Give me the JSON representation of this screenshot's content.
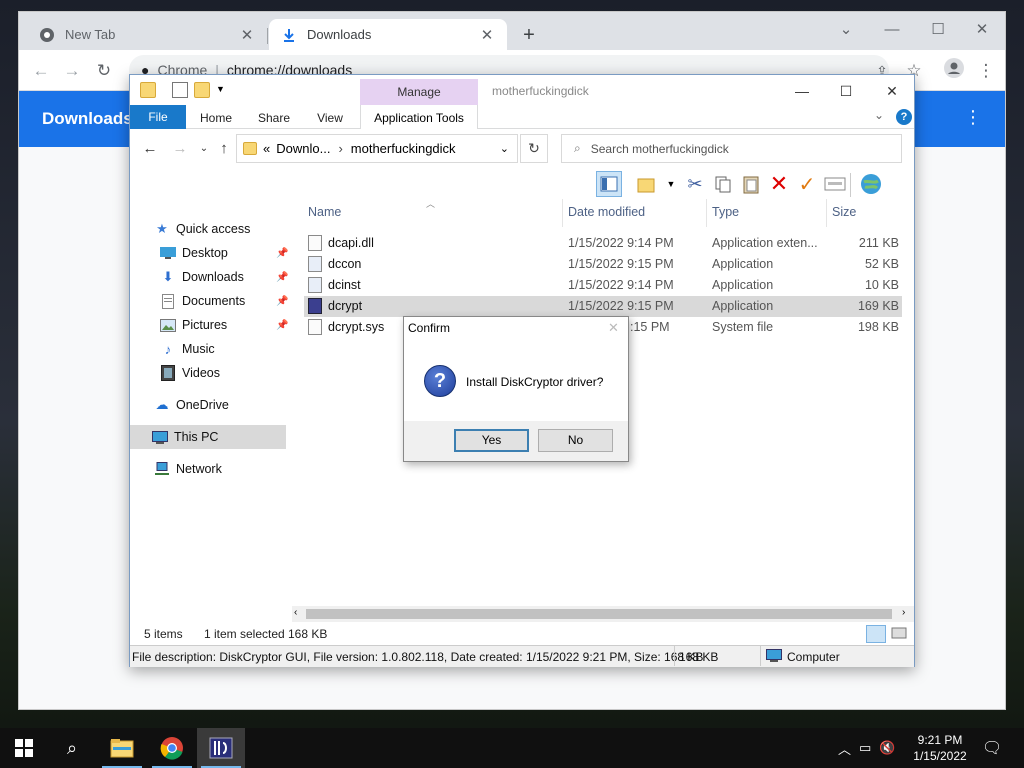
{
  "chrome": {
    "tabs": [
      {
        "label": "New Tab",
        "close": "✕"
      },
      {
        "label": "Downloads",
        "close": "✕"
      }
    ],
    "new_tab": "+",
    "omnibox": {
      "chip": "Chrome",
      "separator": "|",
      "url": "chrome://downloads"
    },
    "page_title": "Downloads"
  },
  "explorer": {
    "window_title": "motherfuckingdick",
    "contextual_group": "Manage",
    "ribbon_tabs": [
      "File",
      "Home",
      "Share",
      "View",
      "Application Tools"
    ],
    "address": {
      "prefix": "«",
      "crumbs": [
        "Downlo...",
        "motherfuckingdick"
      ]
    },
    "search_placeholder": "Search motherfuckingdick",
    "nav": [
      {
        "label": "Quick access"
      },
      {
        "label": "Desktop"
      },
      {
        "label": "Downloads"
      },
      {
        "label": "Documents"
      },
      {
        "label": "Pictures"
      },
      {
        "label": "Music"
      },
      {
        "label": "Videos"
      },
      {
        "label": "OneDrive"
      },
      {
        "label": "This PC"
      },
      {
        "label": "Network"
      }
    ],
    "columns": [
      "Name",
      "Date modified",
      "Type",
      "Size"
    ],
    "files": [
      {
        "name": "dcapi.dll",
        "date": "1/15/2022 9:14 PM",
        "type": "Application exten...",
        "size": "211 KB"
      },
      {
        "name": "dccon",
        "date": "1/15/2022 9:15 PM",
        "type": "Application",
        "size": "52 KB"
      },
      {
        "name": "dcinst",
        "date": "1/15/2022 9:14 PM",
        "type": "Application",
        "size": "10 KB"
      },
      {
        "name": "dcrypt",
        "date": "1/15/2022 9:15 PM",
        "type": "Application",
        "size": "169 KB"
      },
      {
        "name": "dcrypt.sys",
        "date": ":15 PM",
        "type": "System file",
        "size": "198 KB"
      }
    ],
    "status": {
      "items": "5 items",
      "selected": "1 item selected",
      "sel_size": "168 KB"
    },
    "details": {
      "description": "File description: DiskCryptor GUI, File version: 1.0.802.118, Date created: 1/15/2022 9:21 PM, Size: 168 KB",
      "size": "168 KB",
      "location": "Computer"
    }
  },
  "dialog": {
    "title": "Confirm",
    "message": "Install DiskCryptor driver?",
    "yes": "Yes",
    "no": "No"
  },
  "taskbar": {
    "time": "9:21 PM",
    "date": "1/15/2022"
  },
  "colors": {
    "chrome_accent": "#1a73e8",
    "ribbon_file": "#1979ca",
    "manage_tab": "#e6d2f2"
  }
}
